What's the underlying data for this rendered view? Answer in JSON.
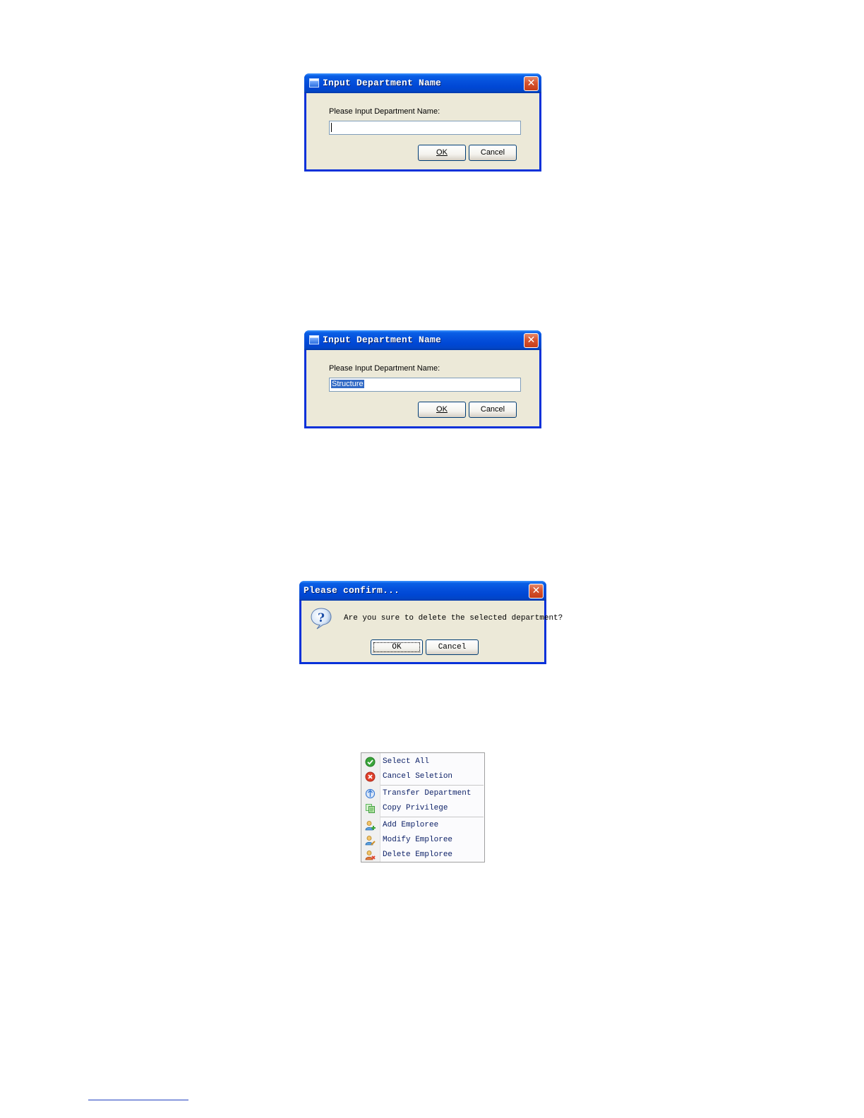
{
  "dialog_1": {
    "title": "Input Department Name",
    "prompt": "Please Input Department Name:",
    "input_value": "",
    "ok_label": "OK",
    "cancel_label": "Cancel",
    "close_glyph": "✕"
  },
  "dialog_2": {
    "title": "Input Department Name",
    "prompt": "Please Input Department Name:",
    "input_value": "Structure",
    "ok_label": "OK",
    "cancel_label": "Cancel",
    "close_glyph": "✕"
  },
  "confirm_dialog": {
    "title": "Please confirm...",
    "message": "Are you sure to delete the selected department?",
    "ok_label": "OK",
    "cancel_label": "Cancel",
    "close_glyph": "✕",
    "icon": "question-icon"
  },
  "context_menu": {
    "groups": [
      [
        {
          "label": "Select All",
          "icon": "check-circle-icon",
          "color": "#3aa53a"
        },
        {
          "label": "Cancel Seletion",
          "icon": "cancel-circle-icon",
          "color": "#e0402a"
        }
      ],
      [
        {
          "label": "Transfer Department",
          "icon": "transfer-icon",
          "color": "#3a7bd5"
        },
        {
          "label": "Copy Privilege",
          "icon": "copy-icon",
          "color": "#5cb85c"
        }
      ],
      [
        {
          "label": "Add Emploree",
          "icon": "add-user-icon",
          "color": "#e0a020"
        },
        {
          "label": "Modify Emploree",
          "icon": "edit-user-icon",
          "color": "#3a7bd5"
        },
        {
          "label": "Delete Emploree",
          "icon": "delete-user-icon",
          "color": "#e0402a"
        }
      ]
    ]
  },
  "colors": {
    "titlebar": "#0551dc",
    "window_face": "#ece9d8",
    "selection": "#316ac5",
    "close_button": "#d6542f"
  }
}
